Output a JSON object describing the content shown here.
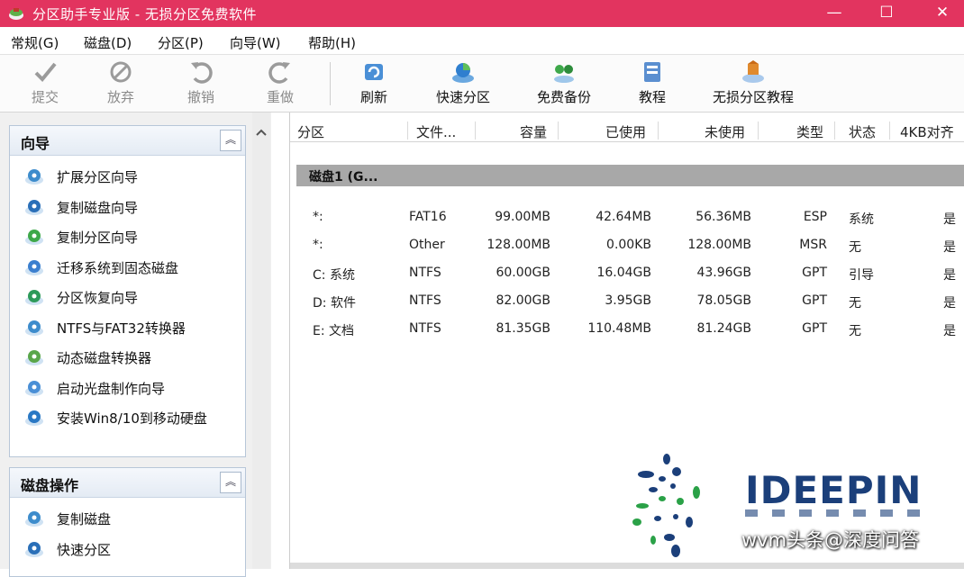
{
  "window": {
    "title": "分区助手专业版 - 无损分区免费软件"
  },
  "menu": [
    "常规(G)",
    "磁盘(D)",
    "分区(P)",
    "向导(W)",
    "帮助(H)"
  ],
  "toolbar": [
    {
      "label": "提交",
      "icon": "check-icon",
      "enabled": false
    },
    {
      "label": "放弃",
      "icon": "discard-icon",
      "enabled": false
    },
    {
      "label": "撤销",
      "icon": "undo-icon",
      "enabled": false
    },
    {
      "label": "重做",
      "icon": "redo-icon",
      "enabled": false
    },
    {
      "label": "刷新",
      "icon": "refresh-icon",
      "enabled": true
    },
    {
      "label": "快速分区",
      "icon": "quick-partition-icon",
      "enabled": true
    },
    {
      "label": "免费备份",
      "icon": "backup-icon",
      "enabled": true
    },
    {
      "label": "教程",
      "icon": "tutorial-icon",
      "enabled": true
    },
    {
      "label": "无损分区教程",
      "icon": "lossless-tutorial-icon",
      "enabled": true
    }
  ],
  "wizard_panel": {
    "title": "向导",
    "items": [
      {
        "label": "扩展分区向导",
        "icon": "extend-partition-icon"
      },
      {
        "label": "复制磁盘向导",
        "icon": "copy-disk-icon"
      },
      {
        "label": "复制分区向导",
        "icon": "copy-partition-icon"
      },
      {
        "label": "迁移系统到固态磁盘",
        "icon": "migrate-os-icon"
      },
      {
        "label": "分区恢复向导",
        "icon": "partition-recovery-icon"
      },
      {
        "label": "NTFS与FAT32转换器",
        "icon": "ntfs-fat32-converter-icon"
      },
      {
        "label": "动态磁盘转换器",
        "icon": "dynamic-disk-icon"
      },
      {
        "label": "启动光盘制作向导",
        "icon": "boot-disc-icon"
      },
      {
        "label": "安装Win8/10到移动硬盘",
        "icon": "windows-to-go-icon"
      }
    ]
  },
  "disk_ops_panel": {
    "title": "磁盘操作",
    "items": [
      {
        "label": "复制磁盘",
        "icon": "copy-disk-icon"
      },
      {
        "label": "快速分区",
        "icon": "quick-partition-icon"
      }
    ]
  },
  "table": {
    "columns": [
      "分区",
      "文件...",
      "容量",
      "已使用",
      "未使用",
      "类型",
      "状态",
      "4KB对齐"
    ],
    "disk_label": "磁盘1 (G...",
    "rows": [
      {
        "partition": "*:",
        "fs": "FAT16",
        "capacity": "99.00MB",
        "used": "42.64MB",
        "unused": "56.36MB",
        "type": "ESP",
        "status": "系统",
        "aligned": "是"
      },
      {
        "partition": "*:",
        "fs": "Other",
        "capacity": "128.00MB",
        "used": "0.00KB",
        "unused": "128.00MB",
        "type": "MSR",
        "status": "无",
        "aligned": "是"
      },
      {
        "partition": "C: 系统",
        "fs": "NTFS",
        "capacity": "60.00GB",
        "used": "16.04GB",
        "unused": "43.96GB",
        "type": "GPT",
        "status": "引导",
        "aligned": "是"
      },
      {
        "partition": "D: 软件",
        "fs": "NTFS",
        "capacity": "82.00GB",
        "used": "3.95GB",
        "unused": "78.05GB",
        "type": "GPT",
        "status": "无",
        "aligned": "是"
      },
      {
        "partition": "E: 文档",
        "fs": "NTFS",
        "capacity": "81.35GB",
        "used": "110.48MB",
        "unused": "81.24GB",
        "type": "GPT",
        "status": "无",
        "aligned": "是"
      }
    ]
  },
  "watermark": {
    "brand": "IDEEPIN",
    "caption": "wvm头条@深度问答"
  },
  "colors": {
    "titlebar": "#e2345f",
    "diskbar": "#a8a8a8",
    "brand_blue": "#1b3f7a",
    "brand_green": "#2aa147"
  }
}
